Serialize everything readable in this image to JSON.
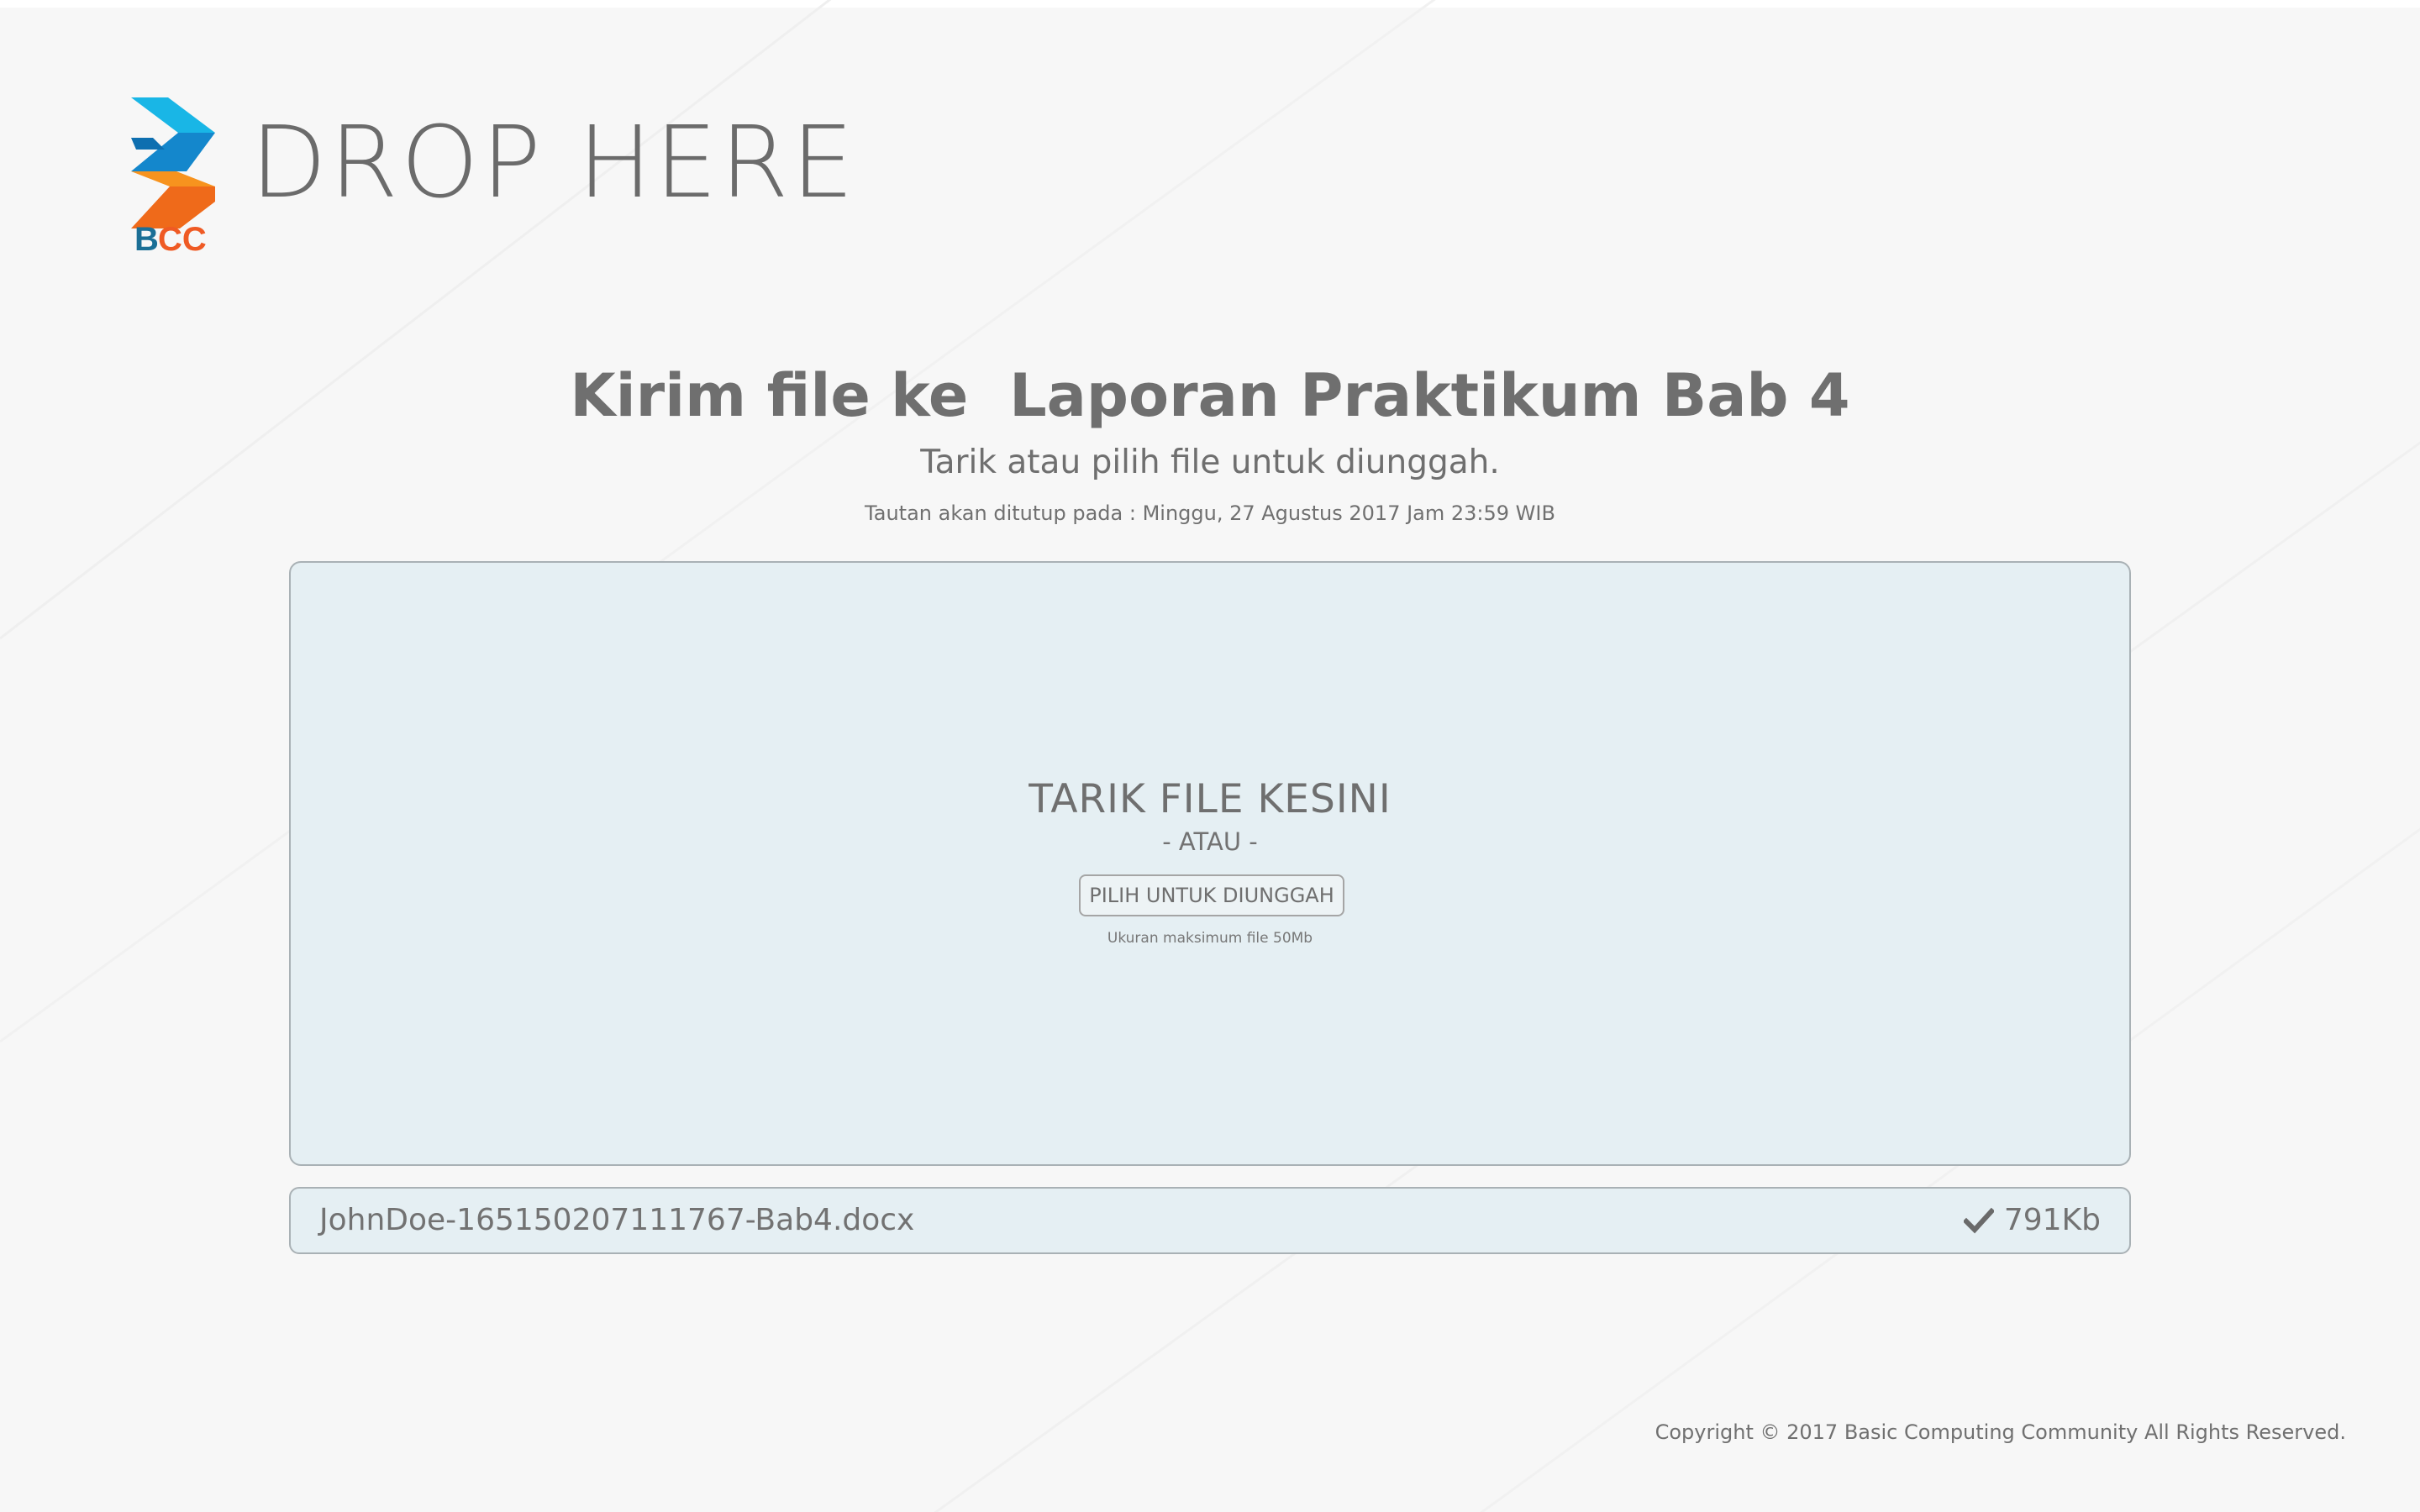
{
  "header": {
    "brand_title": "DROP HERE",
    "logo_text": "BCC",
    "logo_icon": "bcc-logo-icon"
  },
  "main": {
    "heading": "Kirim file ke  Laporan Praktikum Bab 4",
    "subheading": "Tarik atau pilih file untuk diunggah.",
    "deadline": "Tautan akan ditutup pada : Minggu, 27 Agustus 2017 Jam 23:59 WIB"
  },
  "dropzone": {
    "title": "TARIK FILE KESINI",
    "or_text": "- ATAU -",
    "pick_button": "PILIH UNTUK DIUNGGAH",
    "max_size": "Ukuran maksimum file 50Mb"
  },
  "files": [
    {
      "name": "JohnDoe-165150207111767-Bab4.docx",
      "size": "791Kb",
      "status_icon": "check-icon"
    }
  ],
  "footer": {
    "copyright": "Copyright © 2017 Basic Computing Community All Rights Reserved."
  },
  "colors": {
    "background": "#f7f7f7",
    "panel": "#e5eff3",
    "panel_border": "#a9b1b5",
    "text": "#6f6f6f",
    "logo_blue": "#1fa3d8",
    "logo_orange": "#ef6a1a"
  }
}
